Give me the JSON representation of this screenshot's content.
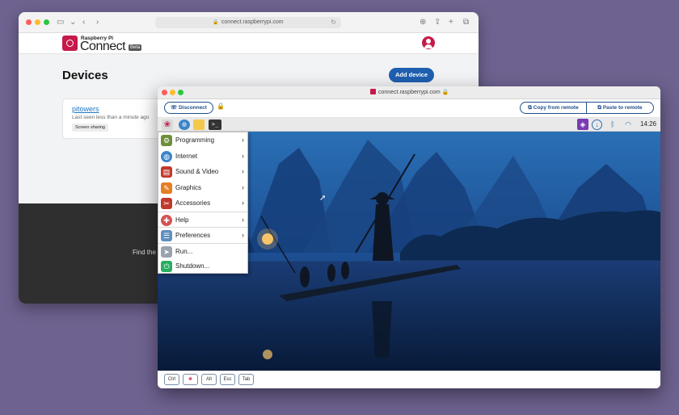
{
  "browser": {
    "url": "connect.raspberrypi.com",
    "brand_small": "Raspberry Pi",
    "brand_big": "Connect",
    "beta_label": "Beta",
    "page_title": "Devices",
    "add_device_label": "Add device",
    "device": {
      "name": "pitowers",
      "last_seen": "Last seen less than a minute ago",
      "badge": "Screen sharing"
    },
    "footer_text": "Find the"
  },
  "remote": {
    "title": "connect.raspberrypi.com",
    "disconnect_label": "Disconnect",
    "copy_from_label": "Copy from remote",
    "paste_to_label": "Paste to remote",
    "clock": "14:26",
    "terminal_glyph": ">_",
    "menu": [
      {
        "label": "Programming",
        "icon": "programming-icon",
        "color": "#6d8f3a",
        "submenu": true
      },
      {
        "label": "Internet",
        "icon": "internet-icon",
        "color": "#3c84c8",
        "submenu": true
      },
      {
        "label": "Sound & Video",
        "icon": "sound-video-icon",
        "color": "#c0392b",
        "submenu": true
      },
      {
        "label": "Graphics",
        "icon": "graphics-icon",
        "color": "#e67e22",
        "submenu": true
      },
      {
        "label": "Accessories",
        "icon": "accessories-icon",
        "color": "#c0392b",
        "submenu": true
      },
      {
        "label": "Help",
        "icon": "help-icon",
        "color": "#d35454",
        "submenu": true
      },
      {
        "label": "Preferences",
        "icon": "preferences-icon",
        "color": "#5f8fbf",
        "submenu": true
      },
      {
        "label": "Run...",
        "icon": "run-icon",
        "color": "#9aa3ad",
        "submenu": false
      },
      {
        "label": "Shutdown...",
        "icon": "shutdown-icon",
        "color": "#27ae60",
        "submenu": false
      }
    ],
    "keys": [
      "Ctrl",
      "",
      "Alt",
      "Esc",
      "Tab"
    ]
  },
  "colors": {
    "accent": "#1f5fb0",
    "brand": "#c51a4a",
    "background": "#6e6290"
  }
}
